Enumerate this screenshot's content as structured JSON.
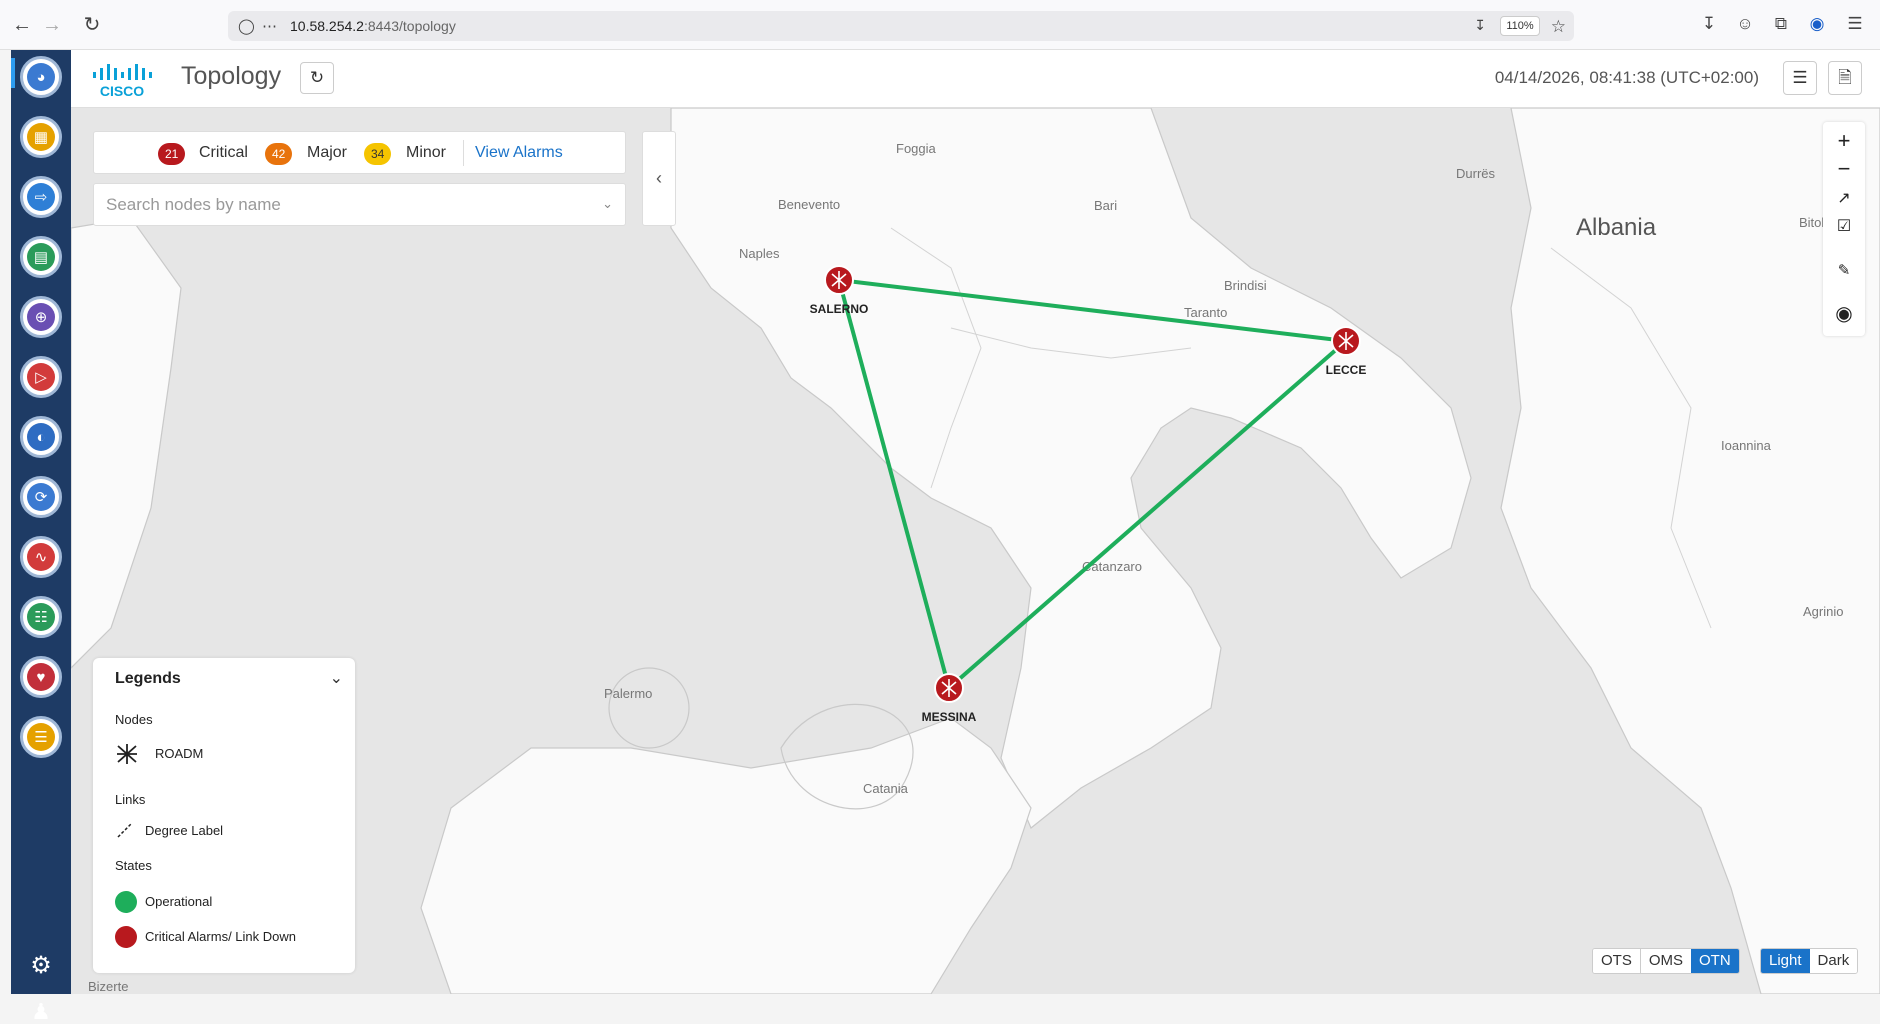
{
  "browser": {
    "url_host": "10.58.254.2",
    "url_path": ":8443/topology",
    "zoom": "110%"
  },
  "header": {
    "logo_text": "CISCO",
    "title": "Topology",
    "timestamp": "04/14/2026, 08:41:38 (UTC+02:00)"
  },
  "alarms": {
    "critical_count": "21",
    "critical_label": "Critical",
    "major_count": "42",
    "major_label": "Major",
    "minor_count": "34",
    "minor_label": "Minor",
    "view_alarms": "View Alarms",
    "colors": {
      "critical": "#b8191e",
      "major": "#e8730c",
      "minor": "#f5c400"
    }
  },
  "search": {
    "placeholder": "Search nodes by name"
  },
  "map": {
    "country_labels": [
      "Albania"
    ],
    "city_labels": [
      "Foggia",
      "Benevento",
      "Bari",
      "Naples",
      "Brindisi",
      "Taranto",
      "Durrës",
      "Bitola",
      "Ioannina",
      "Agrinio",
      "Catanzaro",
      "Palermo",
      "Catania",
      "Bizerte"
    ],
    "nodes": [
      {
        "name": "SALERNO",
        "status": "critical"
      },
      {
        "name": "LECCE",
        "status": "critical"
      },
      {
        "name": "MESSINA",
        "status": "critical"
      }
    ],
    "links": [
      {
        "from": "SALERNO",
        "to": "LECCE",
        "state": "operational"
      },
      {
        "from": "SALERNO",
        "to": "MESSINA",
        "state": "operational"
      },
      {
        "from": "LECCE",
        "to": "MESSINA",
        "state": "operational"
      }
    ],
    "link_color": "#1eae5b",
    "node_color": "#b8191e"
  },
  "legend": {
    "title": "Legends",
    "nodes_heading": "Nodes",
    "node_roadm": "ROADM",
    "links_heading": "Links",
    "link_degree": "Degree Label",
    "states_heading": "States",
    "state_operational": "Operational",
    "state_critical": "Critical Alarms/ Link Down",
    "colors": {
      "operational": "#1eae5b",
      "critical": "#b8191e"
    }
  },
  "layers": {
    "options": [
      "OTS",
      "OMS",
      "OTN"
    ],
    "selected": "OTN"
  },
  "theme": {
    "options": [
      "Light",
      "Dark"
    ],
    "selected": "Light"
  }
}
